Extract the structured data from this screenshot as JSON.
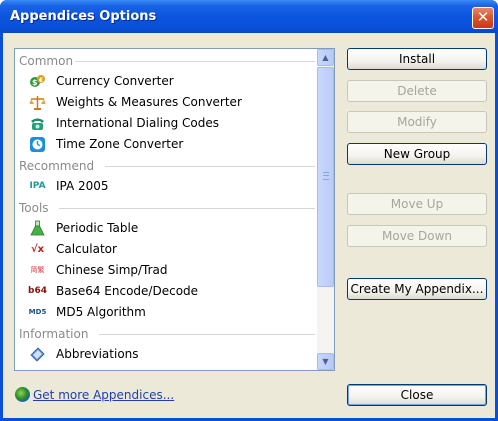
{
  "window": {
    "title": "Appendices Options",
    "close_glyph": "✕"
  },
  "list": {
    "groups": [
      {
        "name": "Common",
        "items": [
          {
            "label": "Currency Converter",
            "icon": "currency-icon"
          },
          {
            "label": "Weights & Measures Converter",
            "icon": "scale-icon"
          },
          {
            "label": "International Dialing Codes",
            "icon": "phone-icon"
          },
          {
            "label": "Time Zone Converter",
            "icon": "clock-icon"
          }
        ]
      },
      {
        "name": "Recommend",
        "items": [
          {
            "label": "IPA 2005",
            "icon": "ipa-icon",
            "icon_text": "IPA"
          }
        ]
      },
      {
        "name": "Tools",
        "items": [
          {
            "label": "Periodic Table",
            "icon": "flask-icon"
          },
          {
            "label": "Calculator",
            "icon": "sqrt-icon",
            "icon_text": "√x"
          },
          {
            "label": "Chinese Simp/Trad",
            "icon": "chinese-char-icon",
            "icon_text": "简繁"
          },
          {
            "label": "Base64 Encode/Decode",
            "icon": "b64-icon",
            "icon_text": "b64"
          },
          {
            "label": "MD5 Algorithm",
            "icon": "md5-icon",
            "icon_text": "MD5"
          }
        ]
      },
      {
        "name": "Information",
        "items": [
          {
            "label": "Abbreviations",
            "icon": "abbreviations-icon"
          }
        ]
      }
    ]
  },
  "buttons": {
    "install": "Install",
    "delete": "Delete",
    "modify": "Modify",
    "new_group": "New Group",
    "move_up": "Move Up",
    "move_down": "Move Down",
    "create": "Create My Appendix...",
    "close": "Close"
  },
  "footer": {
    "link_text": "Get more Appendices..."
  },
  "colors": {
    "title_bar": "#0a4fd8",
    "client_bg": "#ece9d8",
    "link": "#1f3fae",
    "group_header": "#8a8a8a"
  }
}
